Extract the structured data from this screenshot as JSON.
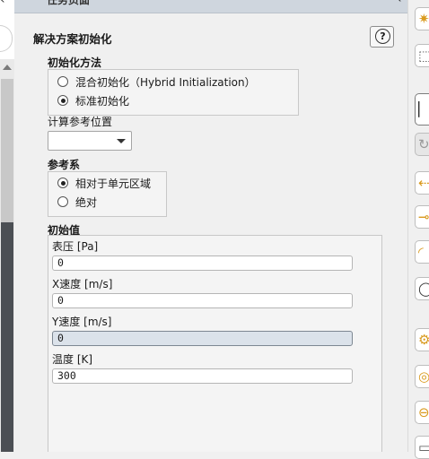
{
  "titlebar": {
    "title": "任务页面"
  },
  "panel": {
    "title": "解决方案初始化",
    "help_glyph": "?"
  },
  "init_method": {
    "title": "初始化方法",
    "options": [
      {
        "label": "混合初始化（Hybrid Initialization）",
        "selected": false
      },
      {
        "label": "标准初始化",
        "selected": true
      }
    ]
  },
  "reference": {
    "title": "计算参考位置",
    "selected_value": ""
  },
  "reference_frame": {
    "title": "参考系",
    "options": [
      {
        "label": "相对于单元区域",
        "selected": true
      },
      {
        "label": "绝对",
        "selected": false
      }
    ]
  },
  "initial_values": {
    "title": "初始值",
    "fields": [
      {
        "label": "表压 [Pa]",
        "value": "0",
        "disabled": false
      },
      {
        "label": "X速度 [m/s]",
        "value": "0",
        "disabled": false
      },
      {
        "label": "Y速度 [m/s]",
        "value": "0",
        "disabled": true
      },
      {
        "label": "温度 [K]",
        "value": "300",
        "disabled": false
      }
    ]
  },
  "toolbar_icons": [
    "gear-icon",
    "cube-icon",
    "layout-icon",
    "refresh-icon",
    "arrow-left-icon",
    "arrow-right-icon",
    "curve-icon",
    "circle-icon",
    "settings-icon",
    "target-icon",
    "minus-icon",
    "tool-icon"
  ],
  "colors": {
    "background": "#f0f0f0",
    "titlebar": "#cfd6de",
    "disabled_field": "#dbe2ea",
    "scroll_dark": "#4b4f54",
    "icon_orange": "#d99a1e"
  }
}
